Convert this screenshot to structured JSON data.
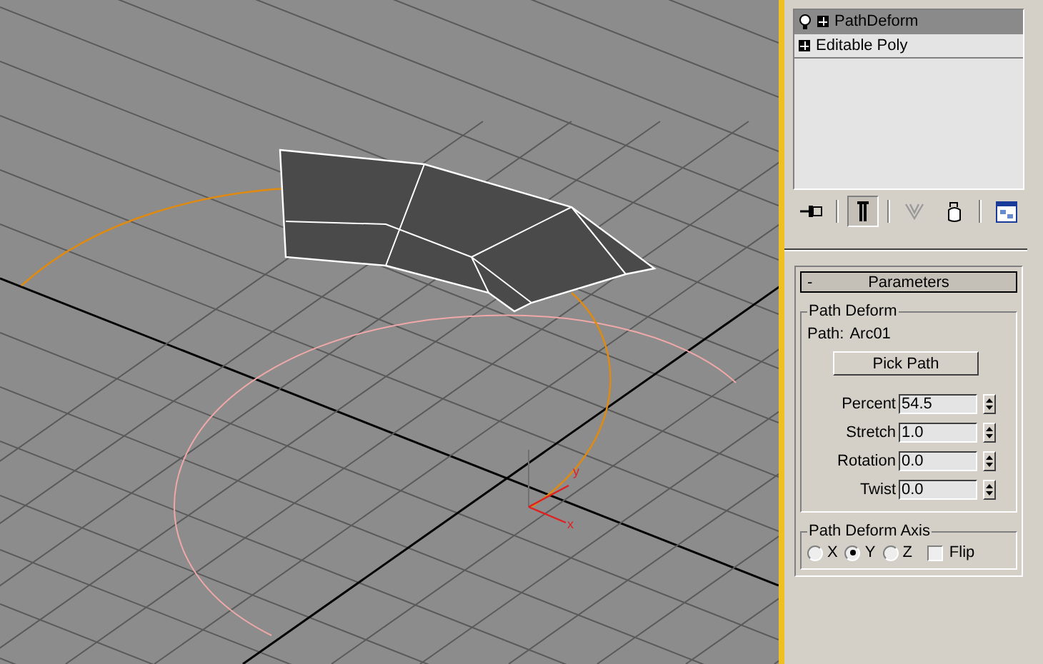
{
  "viewport": {
    "gizmo": {
      "x_label": "x",
      "y_label": "y"
    }
  },
  "modifier_stack": {
    "items": [
      {
        "label": "PathDeform",
        "selected": true,
        "bulb": true
      },
      {
        "label": "Editable Poly",
        "selected": false,
        "bulb": false
      }
    ]
  },
  "stack_toolbar": [
    {
      "kind": "pin",
      "pressed": false,
      "disabled": false
    },
    {
      "kind": "end-result",
      "pressed": true,
      "disabled": false
    },
    {
      "kind": "unique",
      "pressed": false,
      "disabled": true
    },
    {
      "kind": "remove",
      "pressed": false,
      "disabled": false
    },
    {
      "kind": "configure",
      "pressed": false,
      "disabled": false
    }
  ],
  "rollout": {
    "collapse_sign": "-",
    "title": "Parameters",
    "path_group": {
      "title": "Path Deform",
      "path_label": "Path:",
      "path_value": "Arc01",
      "pick_button": "Pick Path",
      "spinners": [
        {
          "label": "Percent",
          "value": "54.5"
        },
        {
          "label": "Stretch",
          "value": "1.0"
        },
        {
          "label": "Rotation",
          "value": "0.0"
        },
        {
          "label": "Twist",
          "value": "0.0"
        }
      ]
    },
    "axis_group": {
      "title": "Path Deform Axis",
      "axes": [
        {
          "label": "X",
          "selected": false
        },
        {
          "label": "Y",
          "selected": true
        },
        {
          "label": "Z",
          "selected": false
        }
      ],
      "flip": {
        "label": "Flip",
        "checked": false
      }
    }
  }
}
